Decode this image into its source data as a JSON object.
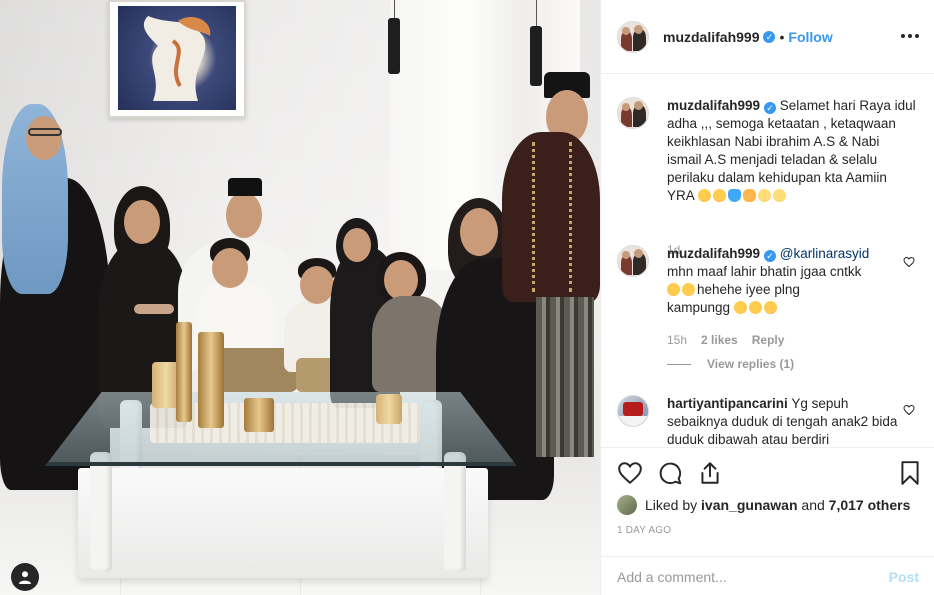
{
  "header": {
    "username": "muzdalifah999",
    "follow_label": "Follow",
    "separator": "•"
  },
  "comments": [
    {
      "username": "muzdalifah999",
      "text": "Selamet hari Raya idul adha ,,, semoga ketaatan , ketaqwaan keikhlasan Nabi ibrahim A.S & Nabi ismail A.S menjadi teladan & selalu perilaku dalam kehidupan kta Aamiin YRA",
      "emojis": [
        "face-blowing-kiss",
        "heart-eyes",
        "blue-heart",
        "open-hands",
        "smiling-halo",
        "smiling-halo"
      ],
      "age": "1d"
    },
    {
      "username": "muzdalifah999",
      "mention": "@karlinarasyid",
      "text_line1": "mhn maaf lahir bhatin jgaa cntkk",
      "text_line2": "hehehe iyee plng",
      "text_line3": "kampungg",
      "age": "15h",
      "likes": "2 likes",
      "reply_label": "Reply",
      "view_replies": "View replies (1)"
    },
    {
      "username": "hartiyantipancarini",
      "text": "Yg sepuh sebaiknya duduk di tengah anak2 bida duduk dibawah atau berdiri"
    }
  ],
  "likes": {
    "prefix": "Liked by",
    "user": "ivan_gunawan",
    "connector": "and",
    "others": "7,017 others"
  },
  "timestamp": "1 DAY AGO",
  "add_comment": {
    "placeholder": "Add a comment...",
    "post_label": "Post"
  },
  "colors": {
    "link_blue": "#3897f0",
    "post_disabled": "#b2dffc",
    "muted": "#999999"
  },
  "icons": [
    "more-icon",
    "heart-icon",
    "comment-icon",
    "share-icon",
    "bookmark-icon",
    "user-icon",
    "verified-icon"
  ]
}
